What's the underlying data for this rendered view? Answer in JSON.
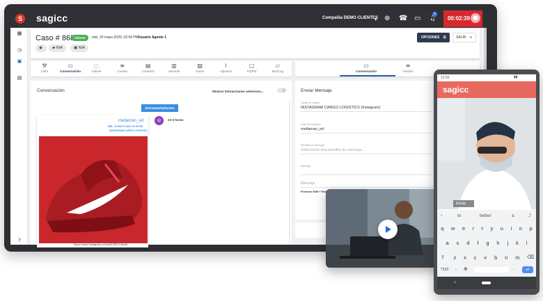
{
  "app": {
    "logo_letter": "S",
    "brand": "sagicc",
    "company": "Compañía DEMO CLIENTES",
    "timer": "00:02:39",
    "notification_count": "1",
    "accent_color": "#d7282f"
  },
  "case": {
    "title": "Caso # 86854",
    "status": "Abierto",
    "date": "mié, 20 mayo 2020, 02:54 PM",
    "agent": "Usuario Agente 1",
    "chip1": "N/A",
    "chip2": "N/A",
    "options_label": "OPCIONES",
    "exit_label": "SALIR"
  },
  "tabs": [
    {
      "label": "Caso",
      "icon": "wrench-icon"
    },
    {
      "label": "Conversación",
      "icon": "chat-icon"
    },
    {
      "label": "Cliente",
      "icon": "user-icon"
    },
    {
      "label": "Cuenta",
      "icon": "list-icon"
    },
    {
      "label": "Contacto",
      "icon": "contact-icon"
    },
    {
      "label": "Historial",
      "icon": "history-icon"
    },
    {
      "label": "Guión",
      "icon": "script-icon"
    },
    {
      "label": "Adjuntos",
      "icon": "clip-icon"
    },
    {
      "label": "PQRsf",
      "icon": "form-icon"
    },
    {
      "label": "MqTLog",
      "icon": "log-icon"
    }
  ],
  "tabs_right": [
    {
      "label": "Conversación",
      "icon": "chat-icon"
    },
    {
      "label": "Gestión",
      "icon": "list-icon"
    }
  ],
  "conversation": {
    "title": "Conversación",
    "show_previous": "Mostrar interacciones anteriores...",
    "direction_button": "Entrantes/Salientes",
    "message": {
      "user": "mellaman_ed",
      "date": "MIE., 20 MAYO 2020, 07:35 PM",
      "channel": "INSTAGRAM CARGO LOGISTICS",
      "link": "https://www.instagram.com/p/B-BRVYd8qfd..."
    },
    "channel_time": "en 5 horas"
  },
  "send": {
    "title": "Enviar Mensaje",
    "fields": [
      {
        "label": "Canal de Salida",
        "value": "INSTAGRAM CARGO LOGISTICS (Instagram)"
      },
      {
        "label": "Dato de contacto",
        "value": "mellaman_ed"
      },
      {
        "label": "Plantilla de Mensaje",
        "value": "Seleccione una plantilla de mensaje..."
      },
      {
        "label": "Mensaje",
        "value": ""
      },
      {
        "label": "",
        "value": "Mensaje"
      }
    ],
    "hint": "Presione Shift + Enter"
  },
  "phone": {
    "status_time": "12:55",
    "brand": "sagicc",
    "bubble": "Enviar",
    "suggestions": [
      "to",
      "better",
      "a"
    ],
    "rows": [
      [
        "q",
        "w",
        "e",
        "r",
        "t",
        "y",
        "u",
        "i",
        "o",
        "p"
      ],
      [
        "a",
        "s",
        "d",
        "f",
        "g",
        "h",
        "j",
        "k",
        "l"
      ],
      [
        "z",
        "x",
        "c",
        "v",
        "b",
        "n",
        "m"
      ]
    ],
    "numkey": "?123"
  }
}
